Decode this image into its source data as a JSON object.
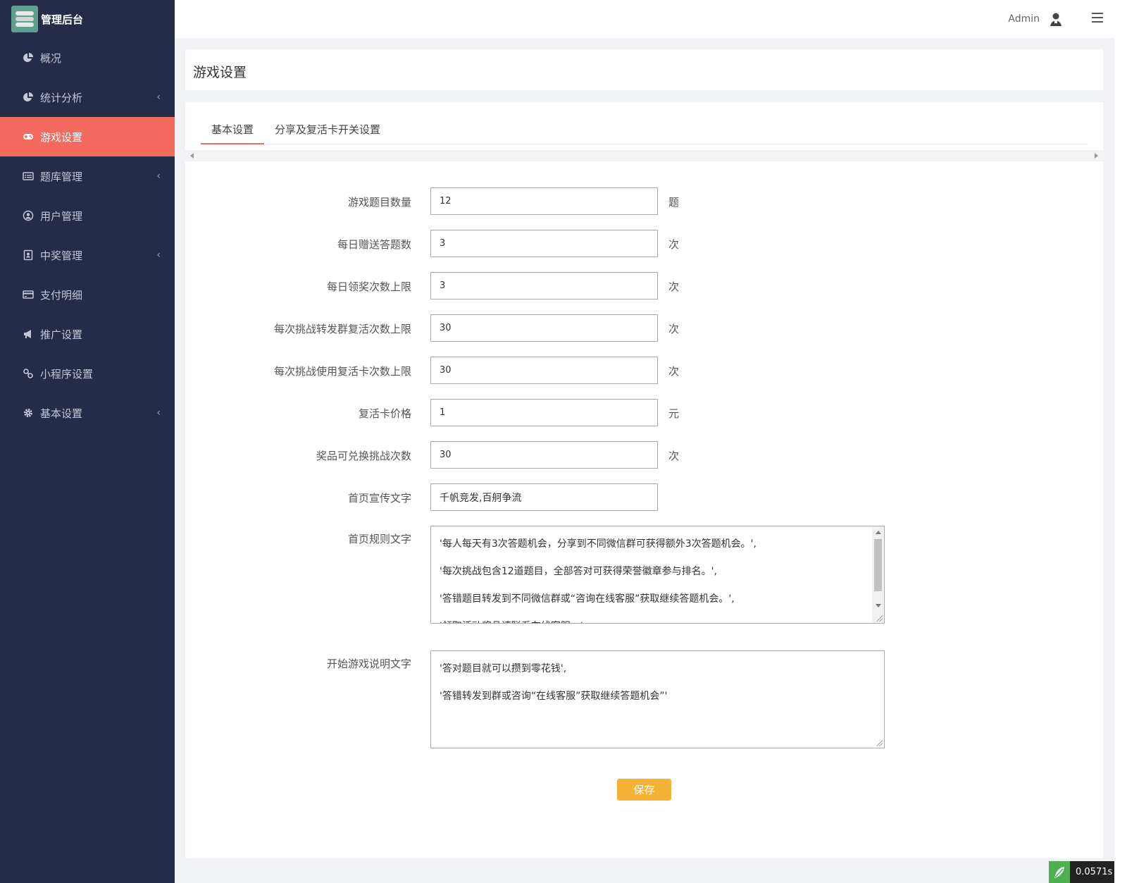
{
  "sidebar": {
    "brand": "管理后台",
    "items": [
      {
        "label": "概况",
        "icon": "pie-chart-icon",
        "active": false
      },
      {
        "label": "统计分析",
        "icon": "pie-chart-icon",
        "active": false,
        "arrow": "‹"
      },
      {
        "label": "游戏设置",
        "icon": "gamepad-icon",
        "active": true
      },
      {
        "label": "题库管理",
        "icon": "list-icon",
        "active": false,
        "arrow": "‹"
      },
      {
        "label": "用户管理",
        "icon": "user-circle-icon",
        "active": false
      },
      {
        "label": "中奖管理",
        "icon": "contact-card-icon",
        "active": false,
        "arrow": "‹"
      },
      {
        "label": "支付明细",
        "icon": "credit-card-icon",
        "active": false
      },
      {
        "label": "推广设置",
        "icon": "bullhorn-icon",
        "active": false
      },
      {
        "label": "小程序设置",
        "icon": "link-icon",
        "active": false
      },
      {
        "label": "基本设置",
        "icon": "gear-icon",
        "active": false,
        "arrow": "‹"
      }
    ]
  },
  "topbar": {
    "user": "Admin"
  },
  "page": {
    "title": "游戏设置"
  },
  "tabs": [
    {
      "label": "基本设置",
      "active": true
    },
    {
      "label": "分享及复活卡开关设置",
      "active": false
    }
  ],
  "form": {
    "fields": [
      {
        "label": "游戏题目数量",
        "value": "12",
        "unit": "题"
      },
      {
        "label": "每日赠送答题数",
        "value": "3",
        "unit": "次"
      },
      {
        "label": "每日领奖次数上限",
        "value": "3",
        "unit": "次"
      },
      {
        "label": "每次挑战转发群复活次数上限",
        "value": "30",
        "unit": "次"
      },
      {
        "label": "每次挑战使用复活卡次数上限",
        "value": "30",
        "unit": "次"
      },
      {
        "label": "复活卡价格",
        "value": "1",
        "unit": "元"
      },
      {
        "label": "奖品可兑换挑战次数",
        "value": "30",
        "unit": "次"
      },
      {
        "label": "首页宣传文字",
        "value": "千帆竞发,百舸争流",
        "unit": ""
      }
    ],
    "rules": {
      "label": "首页规则文字",
      "lines": [
        "'每人每天有3次答题机会，分享到不同微信群可获得额外3次答题机会。',",
        "'每次挑战包含12道题目，全部答对可获得荣誉徽章参与排名。',",
        "'答错题目转发到不同微信群或“咨询在线客服”获取继续答题机会。',",
        "'领取活动奖品请联系在线客服。'"
      ]
    },
    "intro": {
      "label": "开始游戏说明文字",
      "lines": [
        "'答对题目就可以攒到零花钱',",
        "'答错转发到群或咨询“在线客服”获取继续答题机会”'"
      ]
    },
    "save_label": "保存"
  },
  "footer": {
    "timer": "0.0571s"
  }
}
